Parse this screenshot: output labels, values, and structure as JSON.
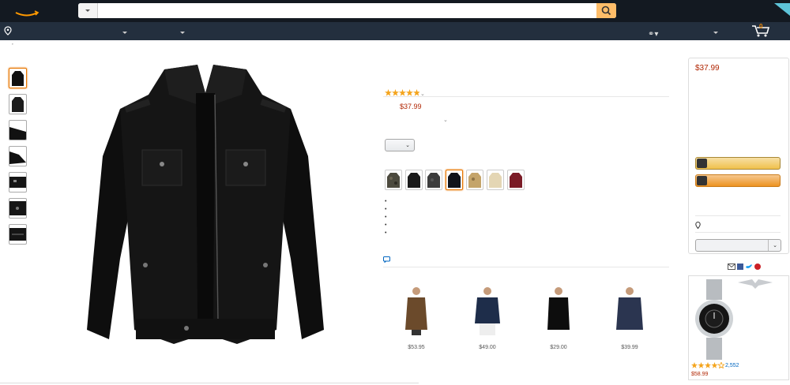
{
  "header": {
    "search": {
      "value": "",
      "placeholder": ""
    },
    "cart_count": "0"
  },
  "product": {
    "price": "$37.99",
    "rating_stars": 5
  },
  "buybox": {
    "price": "$37.99"
  },
  "recommendations": [
    {
      "price": "$53.95"
    },
    {
      "price": "$49.00"
    },
    {
      "price": "$29.00"
    },
    {
      "price": "$39.99"
    }
  ],
  "ad": {
    "rating_stars": 4.5,
    "review_count": "2,552",
    "price": "$58.99"
  },
  "colors": {
    "header_bg": "#131921",
    "nav_bg": "#232f3e",
    "price": "#b12704",
    "accent": "#e77600",
    "search_button": "#febd69"
  }
}
